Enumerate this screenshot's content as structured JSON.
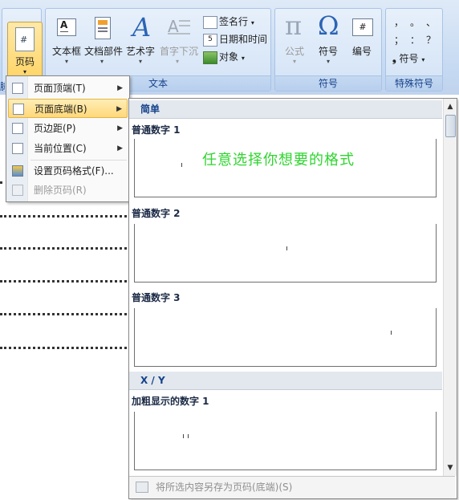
{
  "ribbon": {
    "page_number_label": "页码",
    "groups": {
      "text_label": "文本",
      "symbols_label": "符号",
      "special_label": "特殊符号"
    },
    "buttons": {
      "text_box": "文本框",
      "quick_parts": "文档部件",
      "wordart": "艺术字",
      "drop_cap": "首字下沉",
      "signature_line": "签名行",
      "date_time": "日期和时间",
      "object": "对象",
      "equation": "公式",
      "symbol": "符号",
      "numbering": "编号",
      "special_symbol": "符号"
    },
    "special_glyphs": [
      "，",
      "。",
      "、",
      "；",
      "：",
      "？"
    ],
    "left_cut_label": "脚"
  },
  "menu": {
    "items": [
      {
        "label": "页面顶端(T)",
        "submenu": true
      },
      {
        "label": "页面底端(B)",
        "submenu": true,
        "highlighted": true
      },
      {
        "label": "页边距(P)",
        "submenu": true
      },
      {
        "label": "当前位置(C)",
        "submenu": true
      },
      {
        "label": "设置页码格式(F)...",
        "submenu": false
      },
      {
        "label": "删除页码(R)",
        "submenu": false,
        "disabled": true
      }
    ]
  },
  "gallery": {
    "categories": [
      "简单",
      "X / Y"
    ],
    "items": [
      {
        "title": "普通数字 1"
      },
      {
        "title": "普通数字 2"
      },
      {
        "title": "普通数字 3"
      },
      {
        "title": "加粗显示的数字 1"
      }
    ],
    "hint": "任意选择你想要的格式",
    "footer_label": "将所选内容另存为页码(底端)(S)"
  },
  "colors": {
    "ribbon_label": "#15428b",
    "hint_green": "#2fd52f",
    "highlight": "#ffd87a"
  }
}
